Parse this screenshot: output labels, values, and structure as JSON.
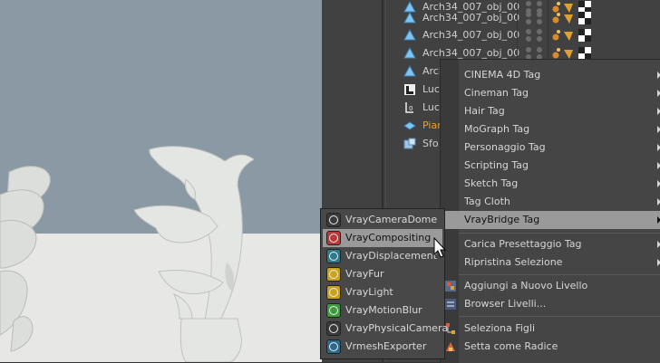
{
  "objects": [
    {
      "name": "Arch34_007_obj_00",
      "icon": "polygon-object-icon"
    },
    {
      "name": "Arch34_007_obj_00",
      "icon": "polygon-object-icon"
    },
    {
      "name": "Arch34_007_obj_00",
      "icon": "polygon-object-icon"
    },
    {
      "name": "Arch34_007_obj_00",
      "icon": "polygon-object-icon"
    },
    {
      "name": "Arch",
      "icon": "polygon-object-icon"
    },
    {
      "name": "Luc",
      "icon": "light-icon"
    },
    {
      "name": "Luc",
      "icon": "area-light-icon"
    },
    {
      "name": "Pian",
      "icon": "plane-icon"
    },
    {
      "name": "Sfo",
      "icon": "background-icon"
    }
  ],
  "context_menu": {
    "items": [
      {
        "label": "CINEMA 4D Tag",
        "submenu": true
      },
      {
        "label": "Cineman Tag",
        "submenu": true
      },
      {
        "label": "Hair Tag",
        "submenu": true
      },
      {
        "label": "MoGraph Tag",
        "submenu": true
      },
      {
        "label": "Personaggio Tag",
        "submenu": true
      },
      {
        "label": "Scripting Tag",
        "submenu": true
      },
      {
        "label": "Sketch Tag",
        "submenu": true
      },
      {
        "label": "Tag Cloth",
        "submenu": true
      },
      {
        "label": "VrayBridge Tag",
        "submenu": true,
        "active": true
      },
      {
        "label": "Carica Presettaggio Tag",
        "submenu": true
      },
      {
        "label": "Ripristina Selezione",
        "submenu": true
      },
      {
        "label": "Aggiungi a Nuovo Livello",
        "icon": "layer-add-icon"
      },
      {
        "label": "Browser Livelli...",
        "icon": "layer-browser-icon"
      },
      {
        "label": "Seleziona Figli",
        "icon": "select-children-icon"
      },
      {
        "label": "Setta come Radice",
        "icon": "set-root-icon"
      }
    ]
  },
  "submenu": {
    "items": [
      {
        "label": "VrayCameraDome",
        "icon": "camera-dome-icon",
        "color": "#3a3a3a"
      },
      {
        "label": "VrayCompositing",
        "icon": "compositing-icon",
        "color": "#b83a3a",
        "active": true
      },
      {
        "label": "VrayDisplacement",
        "icon": "displacement-icon",
        "color": "#2f7a8a"
      },
      {
        "label": "VrayFur",
        "icon": "fur-icon",
        "color": "#c9a21e"
      },
      {
        "label": "VrayLight",
        "icon": "light-tag-icon",
        "color": "#c9a21e"
      },
      {
        "label": "VrayMotionBlur",
        "icon": "motion-blur-icon",
        "color": "#3f9a3f"
      },
      {
        "label": "VrayPhysicalCamera",
        "icon": "physical-camera-icon",
        "color": "#3a3a3a"
      },
      {
        "label": "VrmeshExporter",
        "icon": "vrmesh-exporter-icon",
        "color": "#2f6a8a"
      }
    ]
  }
}
